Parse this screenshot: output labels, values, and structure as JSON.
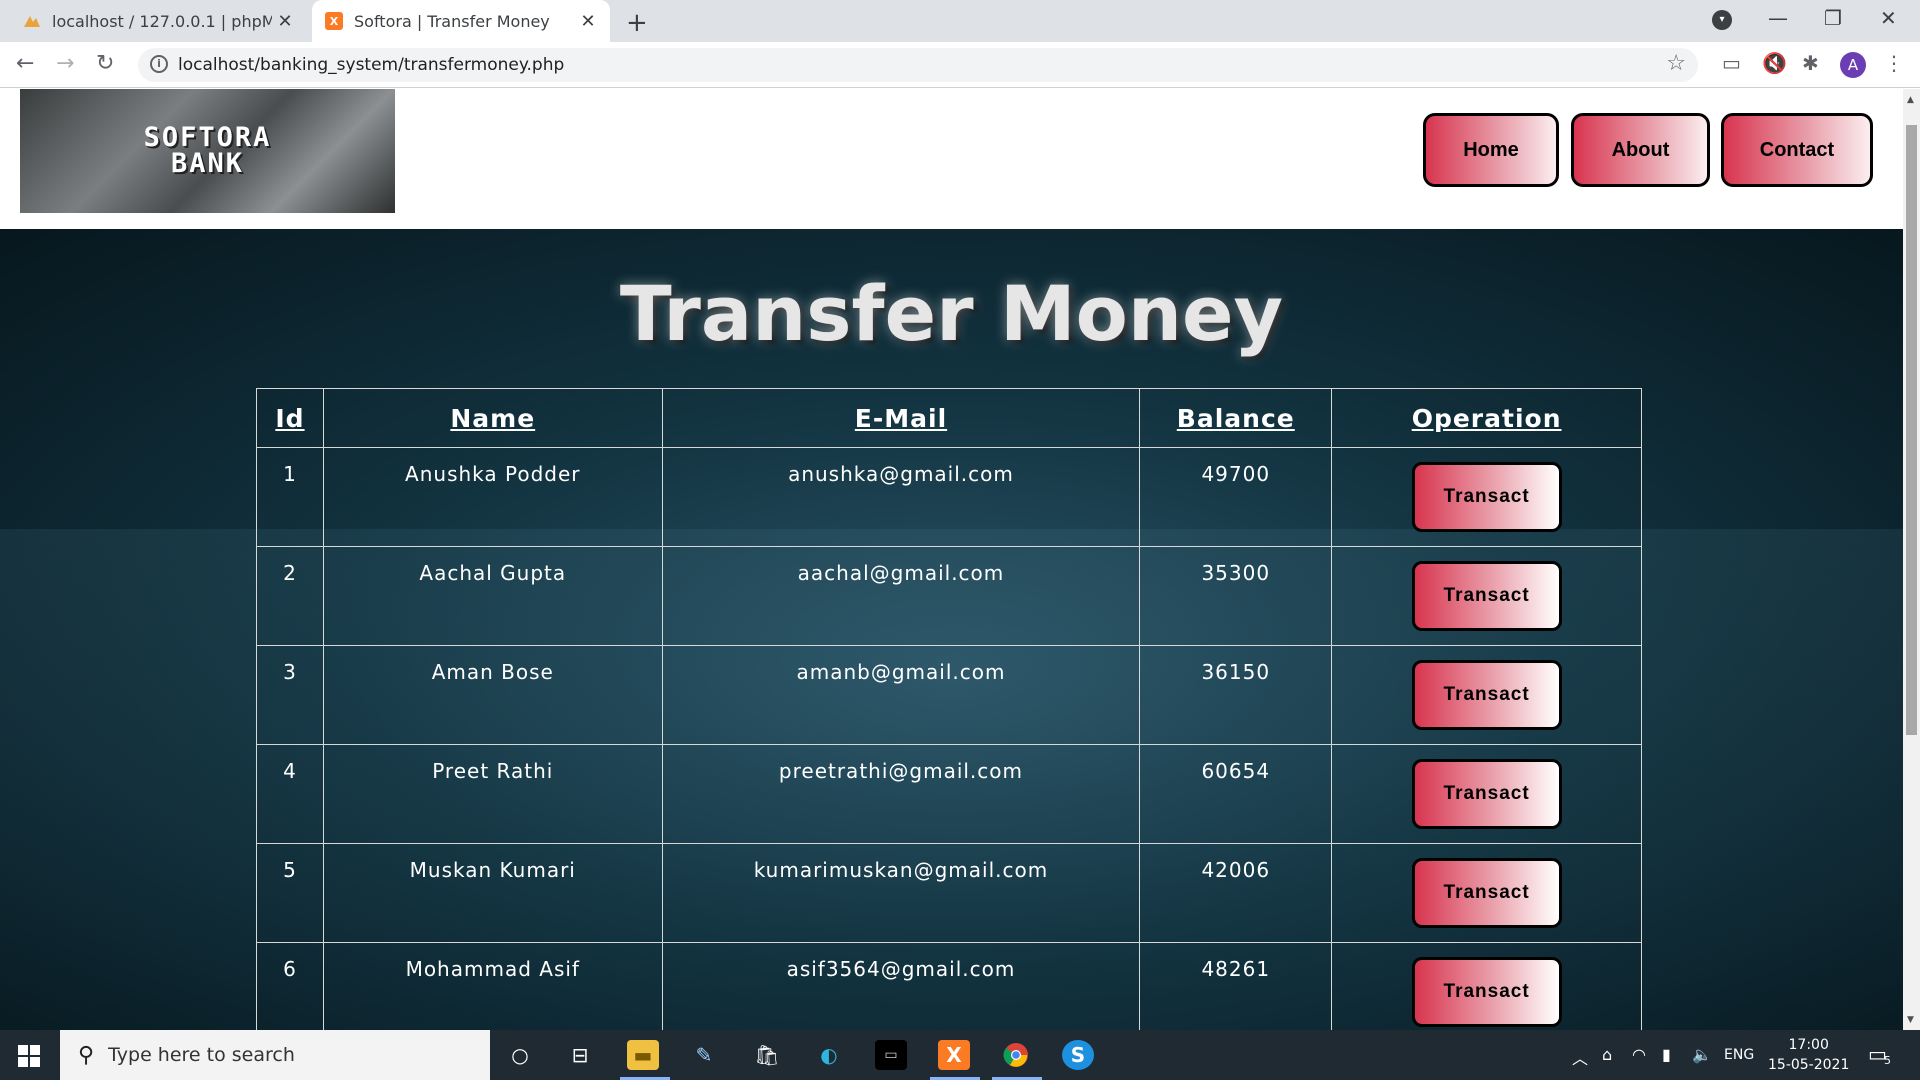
{
  "browser": {
    "tabs": [
      {
        "title": "localhost / 127.0.0.1 | phpMyAdmin",
        "favicon": "phpmyadmin-icon",
        "active": false
      },
      {
        "title": "Softora | Transfer Money",
        "favicon": "xampp-icon",
        "active": true
      }
    ],
    "new_tab": "+",
    "url": "localhost/banking_system/transfermoney.php",
    "profile_initial": "A"
  },
  "header": {
    "logo_line1": "SOFTORA",
    "logo_line2": "BANK",
    "nav": [
      "Home",
      "About",
      "Contact"
    ]
  },
  "main": {
    "title": "Transfer Money",
    "columns": [
      "Id",
      "Name",
      "E-Mail",
      "Balance",
      "Operation"
    ],
    "rows": [
      {
        "id": "1",
        "name": "Anushka Podder",
        "email": "anushka@gmail.com",
        "balance": "49700",
        "action": "Transact"
      },
      {
        "id": "2",
        "name": "Aachal Gupta",
        "email": "aachal@gmail.com",
        "balance": "35300",
        "action": "Transact"
      },
      {
        "id": "3",
        "name": "Aman Bose",
        "email": "amanb@gmail.com",
        "balance": "36150",
        "action": "Transact"
      },
      {
        "id": "4",
        "name": "Preet Rathi",
        "email": "preetrathi@gmail.com",
        "balance": "60654",
        "action": "Transact"
      },
      {
        "id": "5",
        "name": "Muskan Kumari",
        "email": "kumarimuskan@gmail.com",
        "balance": "42006",
        "action": "Transact"
      },
      {
        "id": "6",
        "name": "Mohammad Asif",
        "email": "asif3564@gmail.com",
        "balance": "48261",
        "action": "Transact"
      }
    ]
  },
  "taskbar": {
    "search_placeholder": "Type here to search",
    "language": "ENG",
    "time": "17:00",
    "date": "15-05-2021",
    "notification_count": "5"
  },
  "colors": {
    "button_gradient_start": "#d8354f",
    "hero_dark": "#07171e",
    "hero_light": "#2a5466"
  }
}
